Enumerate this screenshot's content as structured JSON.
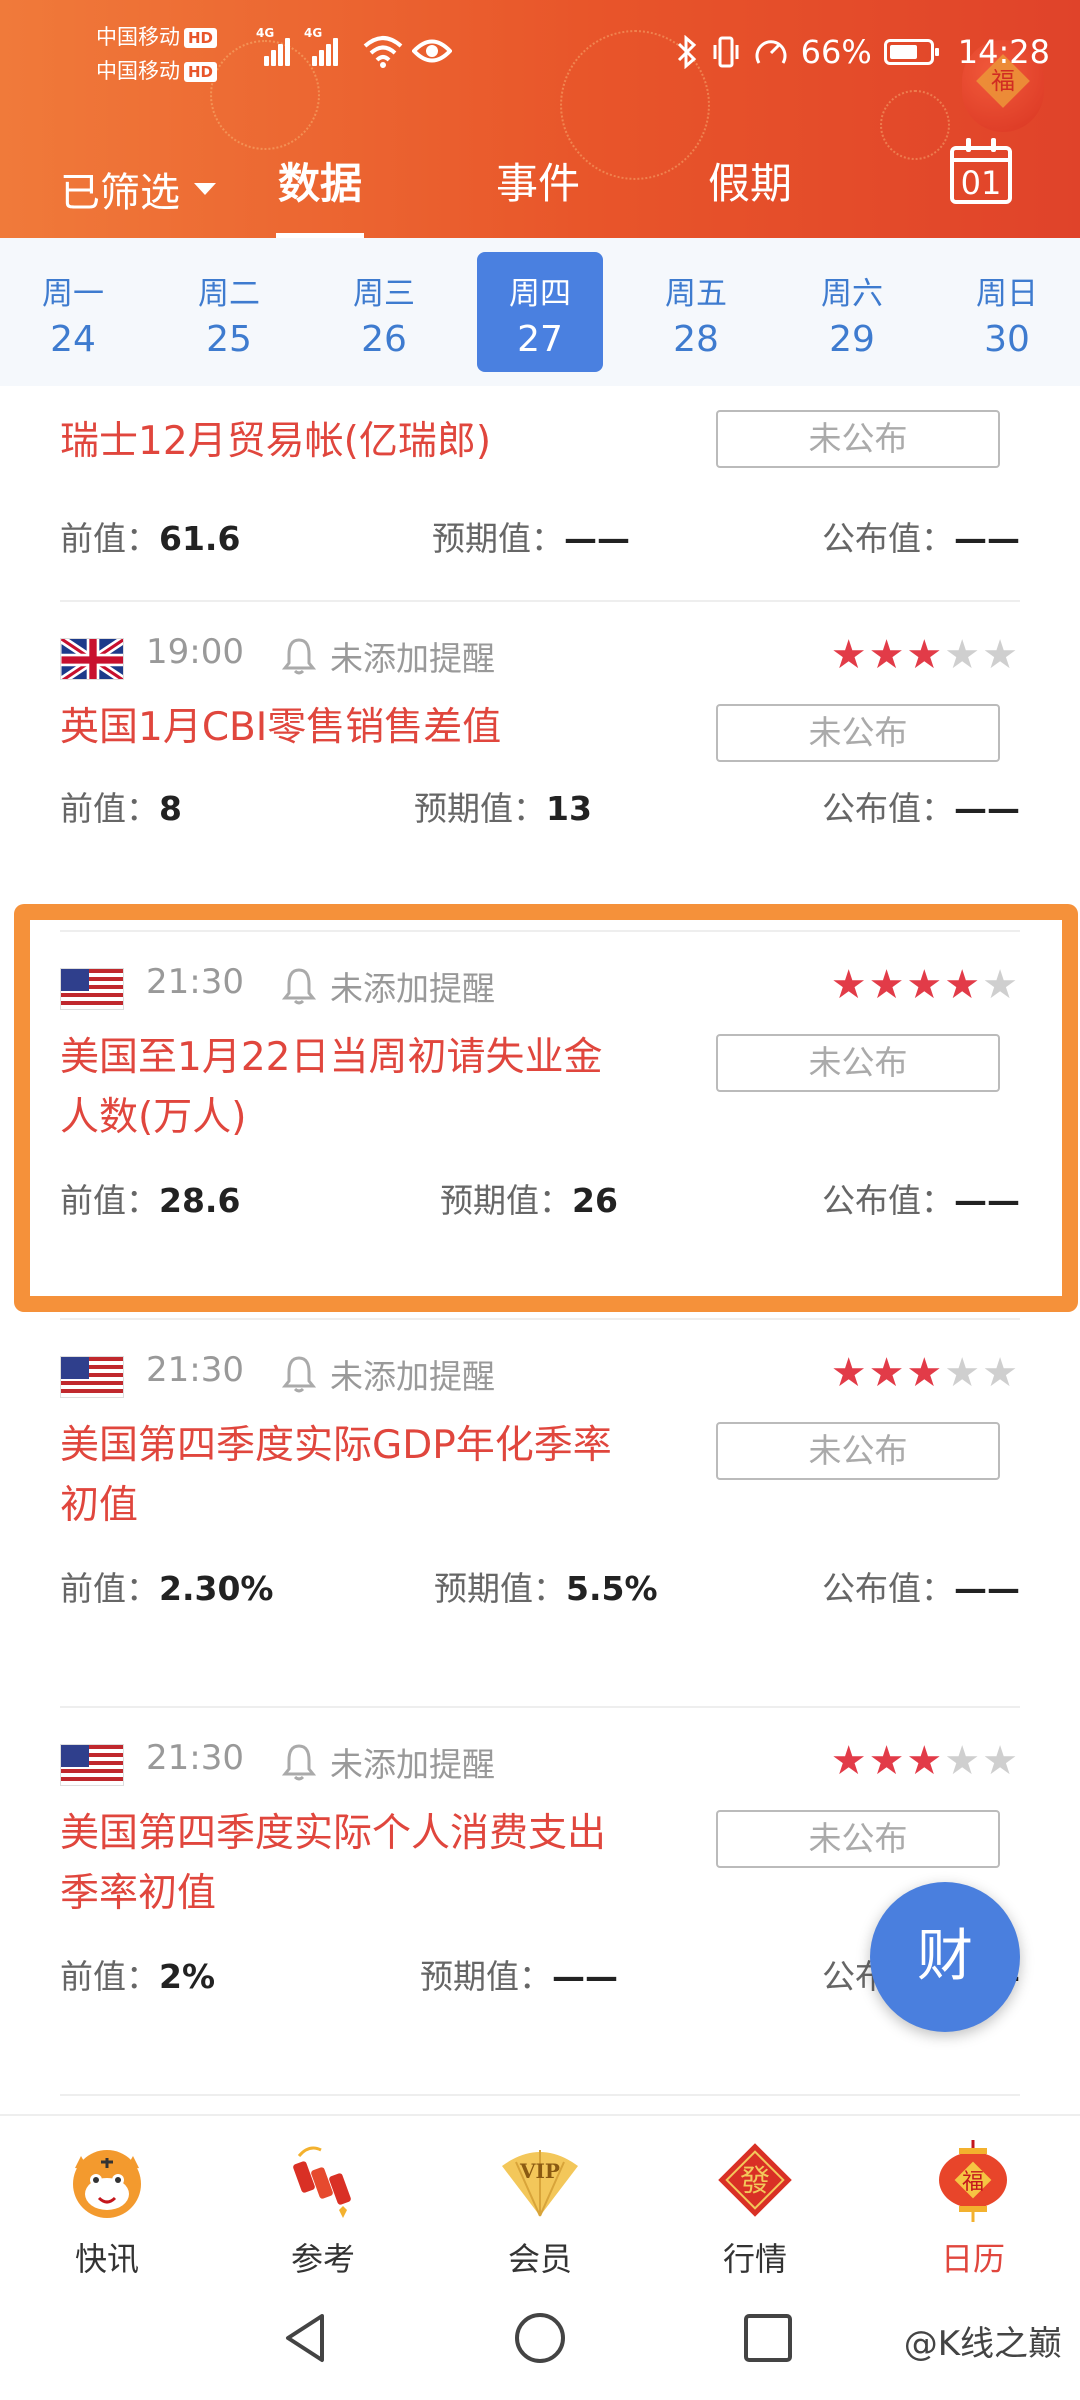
{
  "status_bar": {
    "carrier1": "中国移动",
    "carrier2": "中国移动",
    "hd": "HD",
    "net": "4G",
    "battery": "66%",
    "time": "14:28"
  },
  "header": {
    "filter_label": "已筛选",
    "tabs": [
      {
        "label": "数据"
      },
      {
        "label": "事件"
      },
      {
        "label": "假期"
      }
    ],
    "calendar_day": "01",
    "lantern_char": "福"
  },
  "week": [
    {
      "name": "周一",
      "date": "24"
    },
    {
      "name": "周二",
      "date": "25"
    },
    {
      "name": "周三",
      "date": "26"
    },
    {
      "name": "周四",
      "date": "27"
    },
    {
      "name": "周五",
      "date": "28"
    },
    {
      "name": "周六",
      "date": "29"
    },
    {
      "name": "周日",
      "date": "30"
    }
  ],
  "labels": {
    "prev": "前值：",
    "expected": "预期值：",
    "actual": "公布值："
  },
  "events": [
    {
      "flag": "switzerland",
      "title": "瑞士12月贸易帐(亿瑞郎)",
      "status": "未公布",
      "prev": "61.6",
      "expected": "——",
      "actual": "——"
    },
    {
      "flag": "uk",
      "time": "19:00",
      "remind": "未添加提醒",
      "stars": 3,
      "title": "英国1月CBI零售销售差值",
      "status": "未公布",
      "prev": "8",
      "expected": "13",
      "actual": "——"
    },
    {
      "flag": "us",
      "time": "21:30",
      "remind": "未添加提醒",
      "stars": 4,
      "title_line1": "美国至1月22日当周初请失业金",
      "title_line2": "人数(万人)",
      "status": "未公布",
      "prev": "28.6",
      "expected": "26",
      "actual": "——"
    },
    {
      "flag": "us",
      "time": "21:30",
      "remind": "未添加提醒",
      "stars": 3,
      "title_line1": "美国第四季度实际GDP年化季率",
      "title_line2": "初值",
      "status": "未公布",
      "prev": "2.30%",
      "expected": "5.5%",
      "actual": "——"
    },
    {
      "flag": "us",
      "time": "21:30",
      "remind": "未添加提醒",
      "stars": 3,
      "title_line1": "美国第四季度实际个人消费支出",
      "title_line2": "季率初值",
      "status": "未公布",
      "prev": "2%",
      "expected": "——",
      "actual": "——"
    }
  ],
  "fab": {
    "label": "财"
  },
  "bottom_nav": [
    {
      "label": "快讯",
      "icon": "tiger-icon"
    },
    {
      "label": "参考",
      "icon": "firecracker-icon"
    },
    {
      "label": "会员",
      "icon": "vip-fan-icon"
    },
    {
      "label": "行情",
      "icon": "fa-diamond-icon"
    },
    {
      "label": "日历",
      "icon": "fu-lantern-icon"
    }
  ],
  "bottom_nav_extra": {
    "vip_text": "VIP",
    "fa_char": "發",
    "fu_char": "福"
  },
  "watermark": "@K线之巅",
  "colors": {
    "header_orange": "#e8552a",
    "accent_blue": "#4a80e0",
    "title_red": "#e0463d",
    "star_red": "#e23b48",
    "highlight_orange": "#f5913a"
  }
}
